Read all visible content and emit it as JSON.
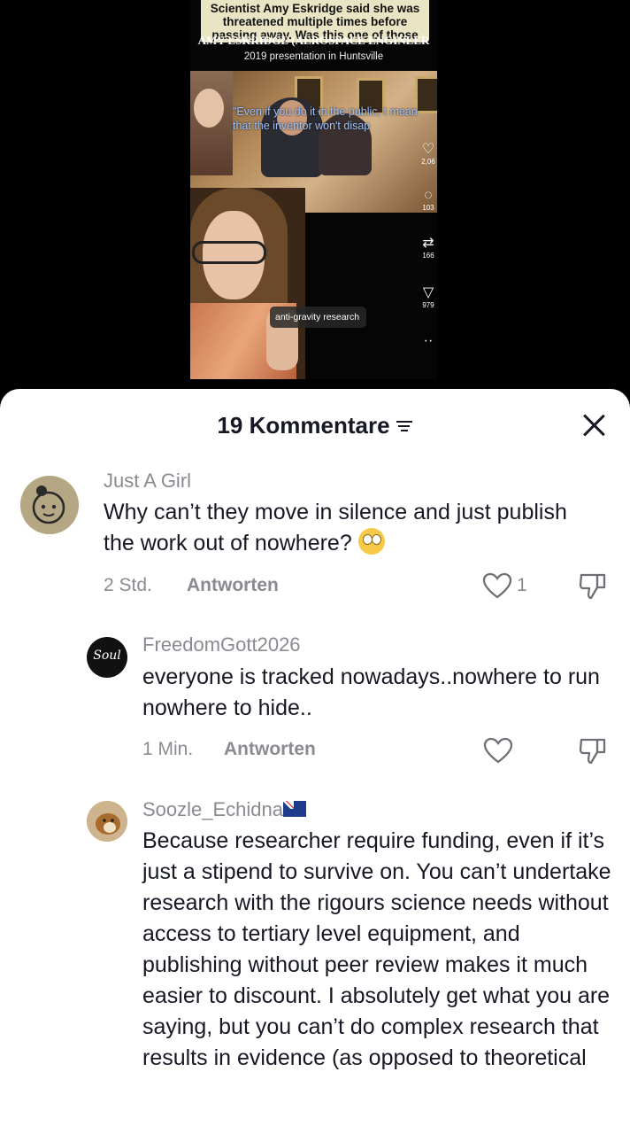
{
  "video": {
    "caption": "Scientist Amy Eskridge said she was threatened multiple times before passing away. Was this one of those times?",
    "title": "AMY ESKRIDGE (AEROSPACE ENGINEER",
    "subtitle": "2019 presentation in Huntsville",
    "quote": "\"Even if you do it in the public, t mean that the inventor won't disap",
    "tag": "anti-gravity research",
    "actions": [
      {
        "icon": "heart-icon",
        "count": "2,06"
      },
      {
        "icon": "comment-icon",
        "count": "103"
      },
      {
        "icon": "repost-icon",
        "count": "166"
      },
      {
        "icon": "share-icon",
        "count": "979"
      }
    ]
  },
  "sheet": {
    "title": "19 Kommentare"
  },
  "comments": [
    {
      "username": "Just A Girl",
      "text": "Why can’t they move in silence and just publish the work out of nowhere?",
      "time": "2 Std.",
      "reply": "Antworten",
      "likes": "1"
    },
    {
      "username": "FreedomGott2026",
      "avatar_text": "Soul",
      "text": "everyone is tracked nowadays..nowhere to run nowhere to hide..",
      "time": "1 Min.",
      "reply": "Antworten",
      "likes": ""
    },
    {
      "username": "Soozle_Echidna",
      "text": "Because researcher require funding, even if it’s just a stipend to survive on. You can’t undertake research with the rigours science needs without access to tertiary level equipment, and publishing without peer review makes it much easier to discount. I absolutely get what you are saying, but you can’t do complex research that results in evidence (as opposed to theoretical"
    }
  ],
  "colors": {
    "text": "#161823",
    "muted": "#8a8b91",
    "sheet_bg": "#ffffff",
    "backdrop": "#000000"
  }
}
